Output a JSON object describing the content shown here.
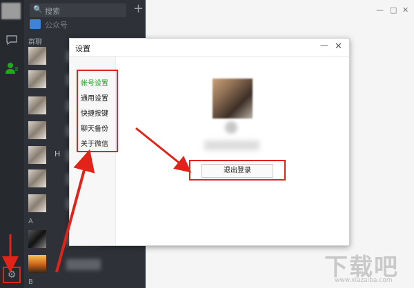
{
  "window": {
    "minimize": "—",
    "maximize": "□",
    "close": "✕"
  },
  "sidebar": {
    "chat_icon": "chat-bubble-icon",
    "contacts_icon": "contacts-icon",
    "settings_icon": "gear-icon"
  },
  "list": {
    "search_placeholder": "搜索",
    "add": "+",
    "public_account": "公众号",
    "section_group": "群聊",
    "section_a": "A",
    "section_b": "B",
    "row_letter": "H"
  },
  "dialog": {
    "title": "设置",
    "minimize": "—",
    "close": "✕",
    "menu": [
      {
        "label": "帐号设置",
        "active": true
      },
      {
        "label": "通用设置",
        "active": false
      },
      {
        "label": "快捷按键",
        "active": false
      },
      {
        "label": "聊天备份",
        "active": false
      },
      {
        "label": "关于微信",
        "active": false
      }
    ],
    "logout_label": "退出登录"
  },
  "colors": {
    "accent_green": "#1aad19",
    "highlight_red": "#e2231a"
  },
  "watermark": {
    "logo": "下载吧",
    "url": "www.xiazaiba.com"
  }
}
